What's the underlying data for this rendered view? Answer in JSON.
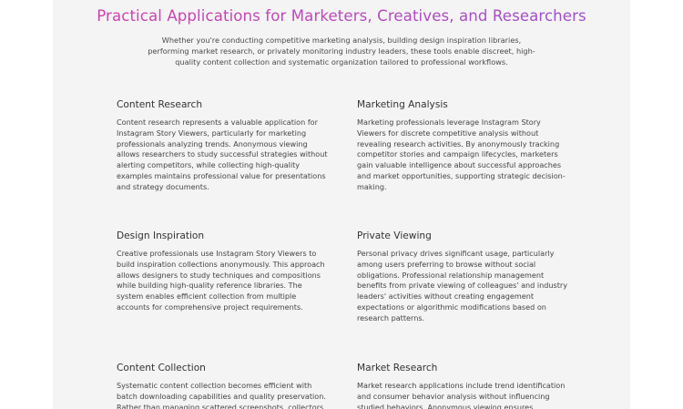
{
  "colors": {
    "title_gradient_start": "#d63fa6",
    "title_gradient_end": "#9a4fd0",
    "panel_background": "#f4f4f5",
    "page_background": "#ffffff",
    "text": "#444444"
  },
  "section": {
    "title": "Practical Applications for Marketers, Creatives, and Researchers",
    "intro": "Whether you're conducting competitive marketing analysis, building design inspiration libraries, performing market research, or privately monitoring industry leaders, these tools enable discreet, high-quality content collection and systematic organization tailored to professional workflows."
  },
  "cards": [
    {
      "title": "Content Research",
      "body": "Content research represents a valuable application for Instagram Story Viewers, particularly for marketing professionals analyzing trends. Anonymous viewing allows researchers to study successful strategies without alerting competitors, while collecting high-quality examples maintains professional value for presentations and strategy documents."
    },
    {
      "title": "Marketing Analysis",
      "body": "Marketing professionals leverage Instagram Story Viewers for discrete competitive analysis without revealing research activities. By anonymously tracking competitor stories and campaign lifecycles, marketers gain valuable intelligence about successful approaches and market opportunities, supporting strategic decision-making."
    },
    {
      "title": "Design Inspiration",
      "body": "Creative professionals use Instagram Story Viewers to build inspiration collections anonymously. This approach allows designers to study techniques and compositions while building high-quality reference libraries. The system enables efficient collection from multiple accounts for comprehensive project requirements."
    },
    {
      "title": "Private Viewing",
      "body": "Personal privacy drives significant usage, particularly among users preferring to browse without social obligations. Professional relationship management benefits from private viewing of colleagues' and industry leaders' activities without creating engagement expectations or algorithmic modifications based on research patterns."
    },
    {
      "title": "Content Collection",
      "body": "Systematic content collection becomes efficient with batch downloading capabilities and quality preservation. Rather than managing scattered screenshots, collectors"
    },
    {
      "title": "Market Research",
      "body": "Market research applications include trend identification and consumer behavior analysis without influencing studied behaviors. Anonymous viewing ensures"
    }
  ]
}
